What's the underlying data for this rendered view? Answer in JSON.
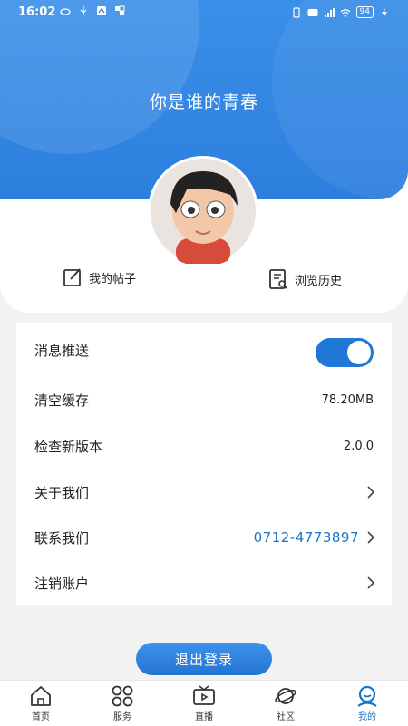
{
  "status_bar": {
    "time": "16:02",
    "battery": "94"
  },
  "profile": {
    "username": "你是谁的青春"
  },
  "quick_actions": {
    "posts_label": "我的帖子",
    "history_label": "浏览历史"
  },
  "settings": {
    "push_label": "消息推送",
    "push_enabled": true,
    "cache_label": "清空缓存",
    "cache_value": "78.20MB",
    "version_label": "检查新版本",
    "version_value": "2.0.0",
    "about_label": "关于我们",
    "contact_label": "联系我们",
    "contact_value": "0712-4773897",
    "deregister_label": "注销账户"
  },
  "logout_label": "退出登录",
  "tabs": [
    {
      "label": "首页",
      "icon": "home-icon"
    },
    {
      "label": "服务",
      "icon": "grid-icon"
    },
    {
      "label": "直播",
      "icon": "tv-icon"
    },
    {
      "label": "社区",
      "icon": "planet-icon"
    },
    {
      "label": "我的",
      "icon": "profile-icon",
      "active": true
    }
  ],
  "colors": {
    "accent": "#1a74c9",
    "header": "#2d7fde"
  }
}
